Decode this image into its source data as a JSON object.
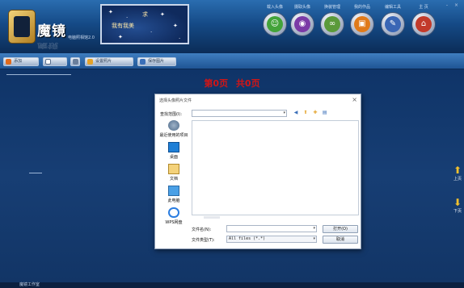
{
  "app": {
    "logo_text": "魔镜",
    "logo_sub": "电脑照相馆2.0",
    "banner_line1": "求",
    "banner_line2": "我有我美"
  },
  "top_icons": [
    {
      "label": "载入头像",
      "icon": "person-icon",
      "color": "#43a33a",
      "glyph": "☺"
    },
    {
      "label": "摄取头像",
      "icon": "webcam-icon",
      "color": "#7b3aa6",
      "glyph": "◉"
    },
    {
      "label": "换装管理",
      "icon": "glasses-icon",
      "color": "#5b9a3a",
      "glyph": "∞"
    },
    {
      "label": "我的作品",
      "icon": "photo-icon",
      "color": "#e07a1a",
      "glyph": "▣"
    },
    {
      "label": "编辑工具",
      "icon": "tools-icon",
      "color": "#3a66b5",
      "glyph": "✎"
    },
    {
      "label": "主 页",
      "icon": "home-icon",
      "color": "#c23a2a",
      "glyph": "⌂"
    }
  ],
  "window_controls": "- ×",
  "toolbar": {
    "btn1": "添加",
    "btn2": "",
    "btn3": "",
    "btn4": "设置照片",
    "btn5": "保存图片"
  },
  "colors": {
    "accent": "#d31515",
    "header": "#154a86",
    "arrow": "#f2c12e"
  },
  "page_counter": {
    "current": "第0页",
    "total": "共0页"
  },
  "side_nav": {
    "up": "上页",
    "down": "下页"
  },
  "dialog": {
    "title": "选择头像照片文件",
    "close": "×",
    "look_in_label": "查找范围(I):",
    "look_in_value": "",
    "places": [
      {
        "label": "最近使用的项目",
        "icon": "recent-icon"
      },
      {
        "label": "桌面",
        "icon": "desktop-icon"
      },
      {
        "label": "文档",
        "icon": "documents-icon"
      },
      {
        "label": "此电脑",
        "icon": "computer-icon"
      },
      {
        "label": "WPS网盘",
        "icon": "cloud-icon"
      }
    ],
    "filename_label": "文件名(N):",
    "filename_value": "",
    "filetype_label": "文件类型(T):",
    "filetype_value": "All files (*.*)",
    "open_button": "打开(O)",
    "cancel_button": "取消"
  },
  "status": {
    "text": "魔镜工作室"
  }
}
